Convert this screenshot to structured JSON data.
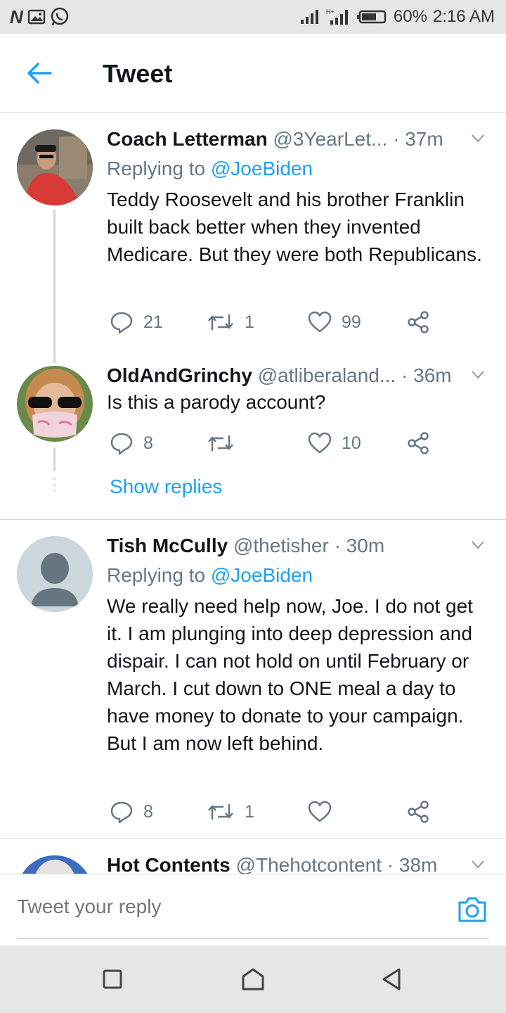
{
  "status_bar": {
    "left_icons": [
      "n-icon",
      "gallery-icon",
      "whatsapp-icon"
    ],
    "battery": "60%",
    "time": "2:16 AM"
  },
  "header": {
    "title": "Tweet"
  },
  "tweets": [
    {
      "name": "Coach Letterman",
      "handle": "@3YearLet...",
      "time": "· 37m",
      "replying_prefix": "Replying to",
      "replying_to": "@JoeBiden",
      "text": "Teddy Roosevelt and his brother Franklin built back better when they invented Medicare. But they were both Republicans.",
      "replies": "21",
      "retweets": "1",
      "likes": "99"
    },
    {
      "name": "OldAndGrinchy",
      "handle": "@atliberaland...",
      "time": "· 36m",
      "text": "Is this a parody account?",
      "replies": "8",
      "retweets": "",
      "likes": "10"
    },
    {
      "name": "Tish McCully",
      "handle": "@thetisher",
      "time": "· 30m",
      "replying_prefix": "Replying to",
      "replying_to": "@JoeBiden",
      "text": "We really need help now, Joe. I do not get it. I am plunging into deep depression and dispair. I can not hold on until February or March. I cut down to ONE meal a day to have money to donate to your campaign. But I am now left behind.",
      "replies": "8",
      "retweets": "1",
      "likes": ""
    },
    {
      "name": "Hot Contents",
      "handle": "@Thehotcontent",
      "time": "· 38m"
    }
  ],
  "show_replies": "Show replies",
  "reply_bar": {
    "placeholder": "Tweet your reply"
  },
  "colors": {
    "accent": "#1da1f2",
    "secondary_text": "#657786",
    "primary_text": "#14171a"
  }
}
